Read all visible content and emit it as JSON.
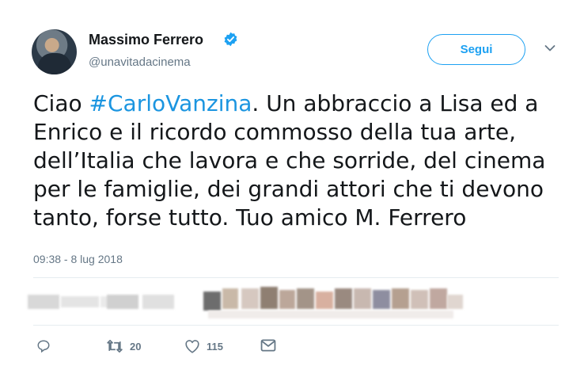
{
  "author": {
    "name": "Massimo Ferrero",
    "handle": "@unavitadacinema",
    "verified_icon": "verified-badge-icon",
    "avatar_icon": "user-avatar"
  },
  "follow_button": {
    "label": "Segui"
  },
  "menu_icon": "chevron-down-icon",
  "tweet": {
    "line1_prefix": "Ciao ",
    "hashtag": "#CarloVanzina",
    "line1_suffix": ". Un abbraccio a Lisa ed a",
    "line2": "Enrico e il ricordo commosso della tua arte,",
    "line3": "dell’Italia che lavora e che sorride, del cinema",
    "line4": "per le famiglie, dei grandi attori che ti devono",
    "line5": "tanto, forse tutto.  Tuo amico M. Ferrero"
  },
  "timestamp": "09:38 - 8 lug 2018",
  "actions": {
    "reply": {
      "icon": "reply-icon"
    },
    "retweet": {
      "icon": "retweet-icon",
      "count": "20"
    },
    "like": {
      "icon": "heart-icon",
      "count": "115"
    },
    "message": {
      "icon": "envelope-icon"
    }
  },
  "colors": {
    "accent": "#1da1f2",
    "hashtag": "#1b95e0",
    "secondary_text": "#657786",
    "divider": "#e6ecf0"
  }
}
